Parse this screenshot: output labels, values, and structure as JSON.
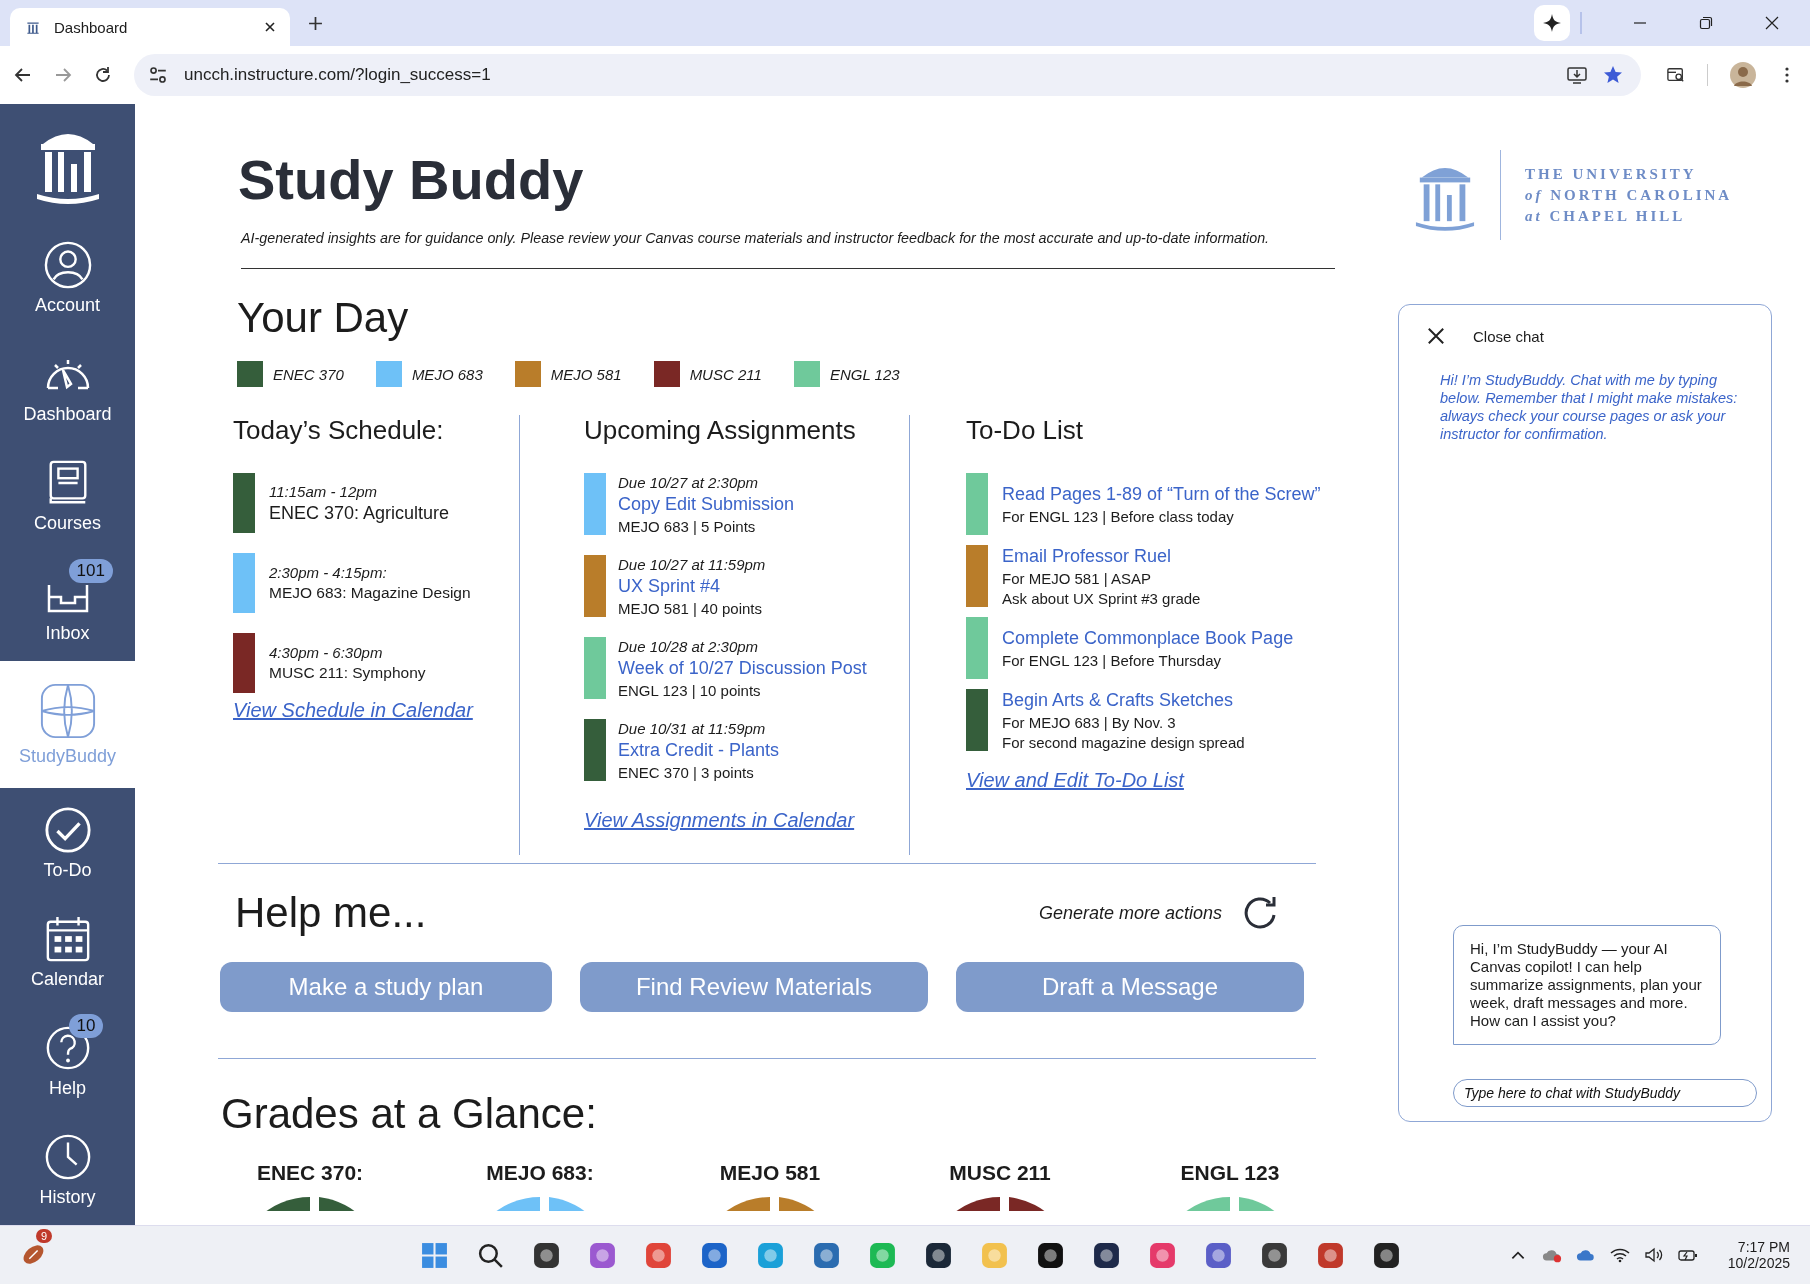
{
  "browser": {
    "tab": {
      "title": "Dashboard"
    },
    "url": "uncch.instructure.com/?login_success=1"
  },
  "sidebar": {
    "items": [
      {
        "label": "Account",
        "kind": "account",
        "selected": false
      },
      {
        "label": "Dashboard",
        "kind": "dashboard",
        "selected": false
      },
      {
        "label": "Courses",
        "kind": "courses",
        "selected": false
      },
      {
        "label": "Inbox",
        "kind": "inbox",
        "selected": false,
        "badge": "101"
      },
      {
        "label": "StudyBuddy",
        "kind": "studybuddy",
        "selected": true
      },
      {
        "label": "To-Do",
        "kind": "todo",
        "selected": false
      },
      {
        "label": "Calendar",
        "kind": "calendar",
        "selected": false
      },
      {
        "label": "Help",
        "kind": "help",
        "selected": false,
        "badge": "10"
      },
      {
        "label": "History",
        "kind": "history",
        "selected": false
      }
    ]
  },
  "header": {
    "title": "Study Buddy",
    "disclaimer": "AI-generated insights are for guidance only. Please review your Canvas course materials and instructor feedback for the most accurate and up-to-date information.",
    "logo": {
      "lines": [
        "THE UNIVERSITY",
        "*of* NORTH CAROLINA",
        "*at* CHAPEL HILL"
      ]
    }
  },
  "your_day": {
    "heading": "Your Day",
    "legend": [
      {
        "label": "ENEC 370",
        "color": "#355e3b"
      },
      {
        "label": "MEJO 683",
        "color": "#6ec1f7"
      },
      {
        "label": "MEJO 581",
        "color": "#b97d2a"
      },
      {
        "label": "MUSC 211",
        "color": "#7a2825"
      },
      {
        "label": "ENGL 123",
        "color": "#6fc99b"
      }
    ],
    "schedule": {
      "heading": "Today’s Schedule:",
      "items": [
        {
          "time": "11:15am - 12pm",
          "title": "ENEC 370: Agriculture",
          "color": "#355e3b"
        },
        {
          "time": "2:30pm - 4:15pm:",
          "title": "MEJO 683: Magazine Design",
          "color": "#6ec1f7"
        },
        {
          "time": "4:30pm - 6:30pm",
          "title": "MUSC 211: Symphony",
          "color": "#7a2825"
        }
      ],
      "link": "View Schedule in Calendar"
    },
    "assignments": {
      "heading": "Upcoming Assignments",
      "items": [
        {
          "due": "Due 10/27 at 2:30pm",
          "title": "Copy Edit Submission",
          "meta": "MEJO 683 | 5 Points",
          "color": "#6ec1f7"
        },
        {
          "due": "Due 10/27 at 11:59pm",
          "title": "UX Sprint #4",
          "meta": "MEJO 581 | 40 points",
          "color": "#b97d2a"
        },
        {
          "due": "Due 10/28 at 2:30pm",
          "title": "Week of 10/27 Discussion Post",
          "meta": "ENGL 123 | 10 points",
          "color": "#6fc99b"
        },
        {
          "due": "Due 10/31 at 11:59pm",
          "title": "Extra Credit - Plants",
          "meta": "ENEC 370 | 3 points",
          "color": "#355e3b"
        }
      ],
      "link": "View Assignments in Calendar"
    },
    "todo": {
      "heading": "To-Do List",
      "items": [
        {
          "title": "Read Pages 1-89 of “Turn of the Screw”",
          "lines": [
            "For ENGL 123 | Before class today"
          ],
          "color": "#6fc99b"
        },
        {
          "title": "Email Professor Ruel",
          "lines": [
            "For MEJO 581 | ASAP",
            "Ask about UX Sprint #3 grade"
          ],
          "color": "#b97d2a"
        },
        {
          "title": "Complete Commonplace Book Page",
          "lines": [
            "For ENGL 123 | Before Thursday"
          ],
          "color": "#6fc99b"
        },
        {
          "title": "Begin Arts & Crafts Sketches",
          "lines": [
            "For MEJO 683 | By Nov. 3",
            "For second magazine design spread"
          ],
          "color": "#355e3b"
        }
      ],
      "link": "View and Edit To-Do List"
    }
  },
  "help": {
    "heading": "Help me...",
    "generate": "Generate more actions",
    "buttons": [
      "Make a study plan",
      "Find Review Materials",
      "Draft a Message"
    ]
  },
  "grades": {
    "heading": "Grades at a Glance:",
    "courses": [
      {
        "label": "ENEC 370:",
        "color": "#355e3b"
      },
      {
        "label": "MEJO 683:",
        "color": "#6ec1f7"
      },
      {
        "label": "MEJO 581",
        "color": "#b97d2a"
      },
      {
        "label": "MUSC 211",
        "color": "#7a2825"
      },
      {
        "label": "ENGL 123",
        "color": "#6fc99b"
      }
    ]
  },
  "chat": {
    "close": "Close chat",
    "intro": "Hi! I’m StudyBuddy. Chat with me by typing below. Remember that I might make mistakes: always check your course pages or ask your instructor for confirmation.",
    "bubble": "Hi, I’m StudyBuddy — your AI Canvas copilot! I can help summarize assignments, plan your week, draft messages and more. How can I assist you?",
    "input": {
      "placeholder": "Type here to chat with StudyBuddy"
    }
  },
  "taskbar": {
    "notification_badge": "9",
    "time": "7:17 PM",
    "date": "10/2/2025"
  }
}
